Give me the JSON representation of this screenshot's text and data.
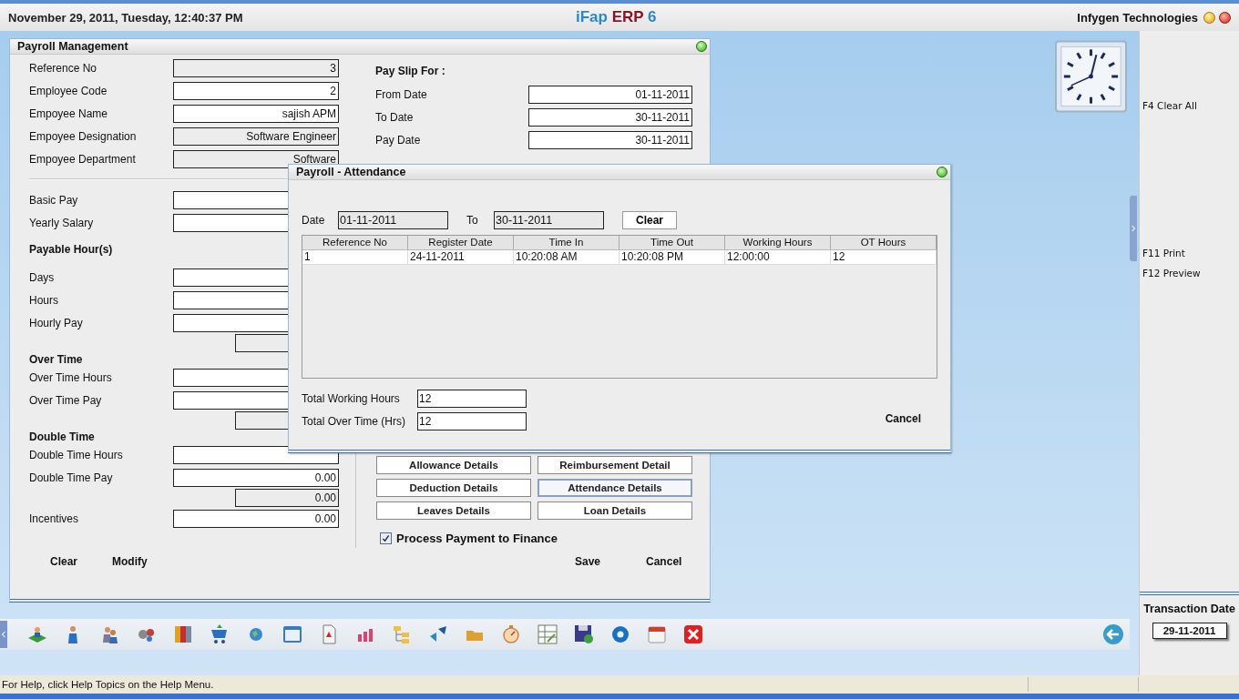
{
  "header": {
    "datetime": "November  29, 2011, Tuesday, 12:40:37 PM",
    "title_parts": [
      "iFap",
      "ERP",
      "6"
    ],
    "company": "Infygen Technologies"
  },
  "payroll_window": {
    "title": "Payroll Management",
    "left_rows": [
      {
        "kind": "field",
        "label": "Reference No",
        "value": "3",
        "readonly": true
      },
      {
        "kind": "field",
        "label": "Employee Code",
        "value": "2",
        "readonly": false
      },
      {
        "kind": "field",
        "label": "Empoyee Name",
        "value": "sajish APM",
        "readonly": false
      },
      {
        "kind": "field",
        "label": "Empoyee Designation",
        "value": "Software Engineer",
        "readonly": true
      },
      {
        "kind": "field",
        "label": "Empoyee Department",
        "value": "Software",
        "readonly": true
      },
      {
        "kind": "divider"
      },
      {
        "kind": "field",
        "label": "Basic Pay",
        "readonly": false
      },
      {
        "kind": "field",
        "label": "Yearly Salary",
        "readonly": false
      },
      {
        "kind": "heading",
        "label": "Payable Hour(s)"
      },
      {
        "kind": "field",
        "label": "Days",
        "readonly": false
      },
      {
        "kind": "field",
        "label": "Hours",
        "readonly": false
      },
      {
        "kind": "field",
        "label": "Hourly Pay",
        "readonly": false
      },
      {
        "kind": "subtotal",
        "readonly": true
      },
      {
        "kind": "heading",
        "label": "Over Time"
      },
      {
        "kind": "field",
        "label": "Over Time Hours",
        "readonly": false
      },
      {
        "kind": "field",
        "label": "Over Time Pay",
        "readonly": false
      },
      {
        "kind": "subtotal",
        "readonly": true
      },
      {
        "kind": "heading",
        "label": "Double Time"
      },
      {
        "kind": "field",
        "label": "Double Time Hours",
        "readonly": false
      },
      {
        "kind": "field",
        "label": "Double Time Pay",
        "value": "0.00",
        "readonly": false
      },
      {
        "kind": "subtotal",
        "value": "0.00",
        "readonly": true
      },
      {
        "kind": "field",
        "label": "Incentives",
        "value": "0.00",
        "readonly": false
      }
    ],
    "pay_slip": {
      "heading": "Pay Slip For :",
      "fields": [
        {
          "label": "From Date",
          "value": "01-11-2011"
        },
        {
          "label": "To Date",
          "value": "30-11-2011"
        },
        {
          "label": "Pay Date",
          "value": "30-11-2011"
        }
      ]
    },
    "detail_buttons": [
      {
        "label": "Allowance Details",
        "selected": false
      },
      {
        "label": "Reimbursement Detail",
        "selected": false
      },
      {
        "label": "Deduction Details",
        "selected": false
      },
      {
        "label": "Attendance Details",
        "selected": true
      },
      {
        "label": "Leaves Details",
        "selected": false
      },
      {
        "label": "Loan Details",
        "selected": false
      }
    ],
    "process_payment": {
      "label": "Process Payment to Finance",
      "checked": true
    },
    "left_actions": [
      "Clear",
      "Modify"
    ],
    "right_actions": [
      "Save",
      "Cancel"
    ]
  },
  "attendance_dialog": {
    "title": "Payroll - Attendance",
    "date_label": "Date",
    "date_from": "01-11-2011",
    "to_label": "To",
    "date_to": "30-11-2011",
    "clear_button": "Clear",
    "table": {
      "columns": [
        "Reference No",
        "Register Date",
        "Time In",
        "Time Out",
        "Working Hours",
        "OT Hours"
      ],
      "rows": [
        [
          "1",
          "24-11-2011",
          "10:20:08 AM",
          "10:20:08 PM",
          "12:00:00",
          "12"
        ]
      ]
    },
    "totals": [
      {
        "label": "Total Working Hours",
        "value": "12"
      },
      {
        "label": "Total Over Time (Hrs)",
        "value": "12"
      }
    ],
    "cancel_button": "Cancel"
  },
  "side_panel": {
    "shortcut_groups": [
      [
        "F4 Clear All"
      ],
      [
        "F11 Print",
        "F12 Preview"
      ]
    ],
    "transaction_label": "Transaction Date",
    "transaction_date": "29-11-2011"
  },
  "status_bar": {
    "text": "For Help, click Help Topics on the Help Menu."
  }
}
